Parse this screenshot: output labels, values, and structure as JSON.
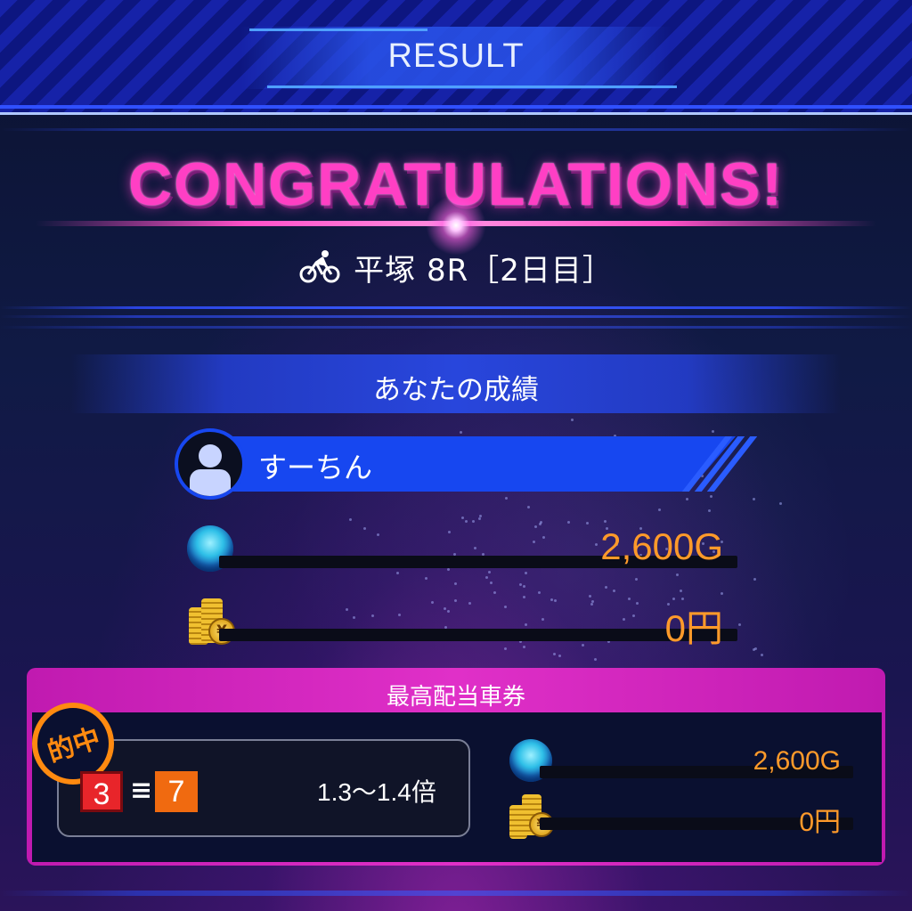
{
  "header": {
    "title": "RESULT"
  },
  "congrats": {
    "headline": "CONGRATULATIONS!",
    "race_icon": "bicycle-icon",
    "race_label": "平塚 8R［2日目］"
  },
  "your_result": {
    "section_title": "あなたの成績",
    "user_name": "すーちん",
    "avatar_icon": "user-avatar-icon",
    "gem_icon": "gem-icon",
    "gem_value": "2,600G",
    "yen_icon": "yen-coins-icon",
    "yen_value": "0円"
  },
  "best_ticket": {
    "section_title": "最高配当車券",
    "hit_badge": "的中",
    "numbers": [
      "3",
      "7"
    ],
    "number_colors": [
      "#e8252a",
      "#f06a10"
    ],
    "combo_symbol": "≡",
    "odds": "1.3〜1.4倍",
    "gem_value": "2,600G",
    "yen_value": "0円",
    "yen_symbol": "¥"
  },
  "colors": {
    "accent_pink": "#ff3fc4",
    "accent_blue": "#1747f0",
    "value_orange": "#ff9a2a"
  }
}
